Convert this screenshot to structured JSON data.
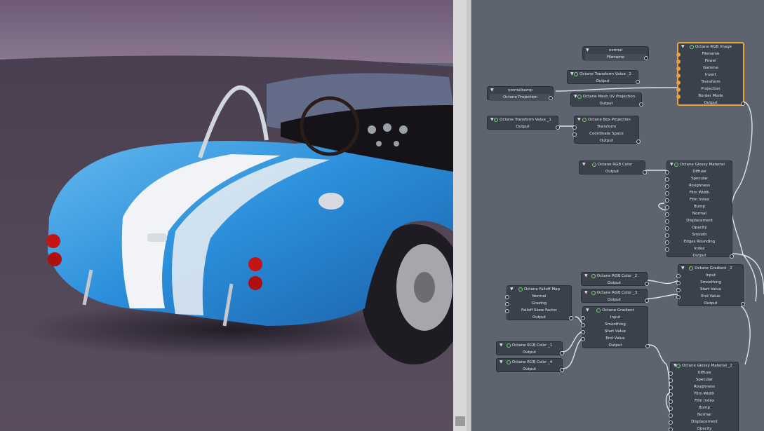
{
  "render_view": {
    "caption": ""
  },
  "graph": {
    "nodes": {
      "normal": {
        "title": "normal",
        "field": "Filename"
      },
      "tv2": {
        "title": "Octane Transform Value _2",
        "out": "Output"
      },
      "normalbump": {
        "title": "normalbump",
        "field": "Octane Projection"
      },
      "meshuv": {
        "title": "Octane Mesh UV Projection",
        "out": "Output"
      },
      "rgbimg": {
        "title": "Octane RGB Image",
        "inputs": [
          "Filename",
          "Power",
          "Gamma",
          "Invert",
          "Transform",
          "Projection",
          "Border Mode"
        ],
        "out": "Output"
      },
      "tv1": {
        "title": "Octane Transform Value _1",
        "out": "Output"
      },
      "boxproj": {
        "title": "Octane Box Projection",
        "inputs": [
          "Transform",
          "Coordinate Space"
        ],
        "out": "Output"
      },
      "rgbcolor": {
        "title": "Octane RGB Color",
        "out": "Output"
      },
      "glossy": {
        "title": "Octane Glossy Material",
        "inputs": [
          "Diffuse",
          "Specular",
          "Roughness",
          "Film Width",
          "Film Index",
          "Bump",
          "Normal",
          "Displacement",
          "Opacity",
          "Smooth",
          "Edges Rounding",
          "Index"
        ],
        "out": "Output"
      },
      "rgbc2": {
        "title": "Octane RGB Color _2",
        "out": "Output"
      },
      "rgbc3": {
        "title": "Octane RGB Color _3",
        "out": "Output"
      },
      "grad2": {
        "title": "Octane Gradient _2",
        "inputs": [
          "Input",
          "Smoothing",
          "Start Value",
          "End Value"
        ],
        "out": "Output"
      },
      "falloff": {
        "title": "Octane Falloff Map",
        "inputs": [
          "Normal",
          "Grazing",
          "Falloff Skew Factor"
        ],
        "out": "Output"
      },
      "grad": {
        "title": "Octane Gradient",
        "inputs": [
          "Input",
          "Smoothing",
          "Start Value",
          "End Value"
        ],
        "out": "Output"
      },
      "rgbc1": {
        "title": "Octane RGB Color _1",
        "out": "Output"
      },
      "rgbc4": {
        "title": "Octane RGB Color _4",
        "out": "Output"
      },
      "glossy2": {
        "title": "Octane Glossy Material _2",
        "inputs": [
          "Diffuse",
          "Specular",
          "Roughness",
          "Film Width",
          "Film Index",
          "Bump",
          "Normal",
          "Displacement",
          "Opacity"
        ]
      }
    }
  },
  "colors": {
    "graph_bg": "#5d6470",
    "node_bg": "#3b414b",
    "selected": "#e9a53a",
    "wire": "#dfe3ea",
    "car_blue": "#2f8fd8"
  }
}
